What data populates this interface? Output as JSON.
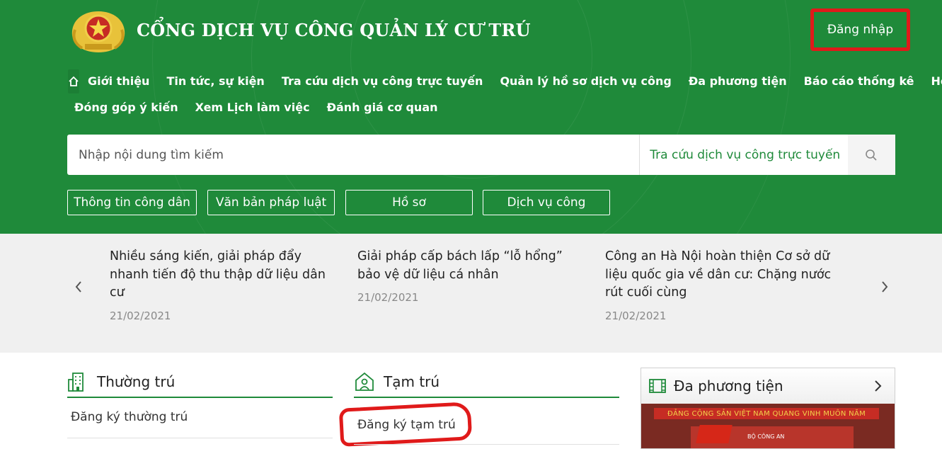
{
  "header": {
    "title": "CỔNG DỊCH VỤ CÔNG QUẢN LÝ CƯ TRÚ",
    "login_label": "Đăng nhập",
    "colors": {
      "primary": "#1f8a3a",
      "highlight": "#e01a1a"
    }
  },
  "nav": {
    "home_icon": "home-icon",
    "row1": [
      "Giới thiệu",
      "Tin tức, sự kiện",
      "Tra cứu dịch vụ công trực tuyến",
      "Quản lý hồ sơ dịch vụ công",
      "Đa phương tiện",
      "Báo cáo thống kê",
      "Hỏi đáp"
    ],
    "row2": [
      "Đóng góp ý kiến",
      "Xem Lịch làm việc",
      "Đánh giá cơ quan"
    ]
  },
  "search": {
    "placeholder": "Nhập nội dung tìm kiếm",
    "select_value": "Tra cứu dịch vụ công trực tuyến",
    "button_icon": "search-icon"
  },
  "quick_links": [
    "Thông tin công dân",
    "Văn bản pháp luật",
    "Hồ sơ",
    "Dịch vụ công"
  ],
  "news": [
    {
      "title": "Nhiều sáng kiến, giải pháp đẩy nhanh tiến độ thu thập dữ liệu dân cư",
      "date": "21/02/2021"
    },
    {
      "title": "Giải pháp cấp bách lấp “lỗ hổng” bảo vệ dữ liệu cá nhân",
      "date": "21/02/2021"
    },
    {
      "title": "Công an Hà Nội hoàn thiện Cơ sở dữ liệu quốc gia về dân cư: Chặng nước rút cuối cùng",
      "date": "21/02/2021"
    }
  ],
  "sections": {
    "permanent": {
      "title": "Thường trú",
      "link": "Đăng ký thường trú"
    },
    "temporary": {
      "title": "Tạm trú",
      "link": "Đăng ký tạm trú"
    },
    "media": {
      "title": "Đa phương tiện",
      "banner": "ĐẢNG CỘNG SẢN VIỆT NAM QUANG VINH MUÔN NĂM",
      "stage_text": "BỘ CÔNG AN"
    }
  }
}
